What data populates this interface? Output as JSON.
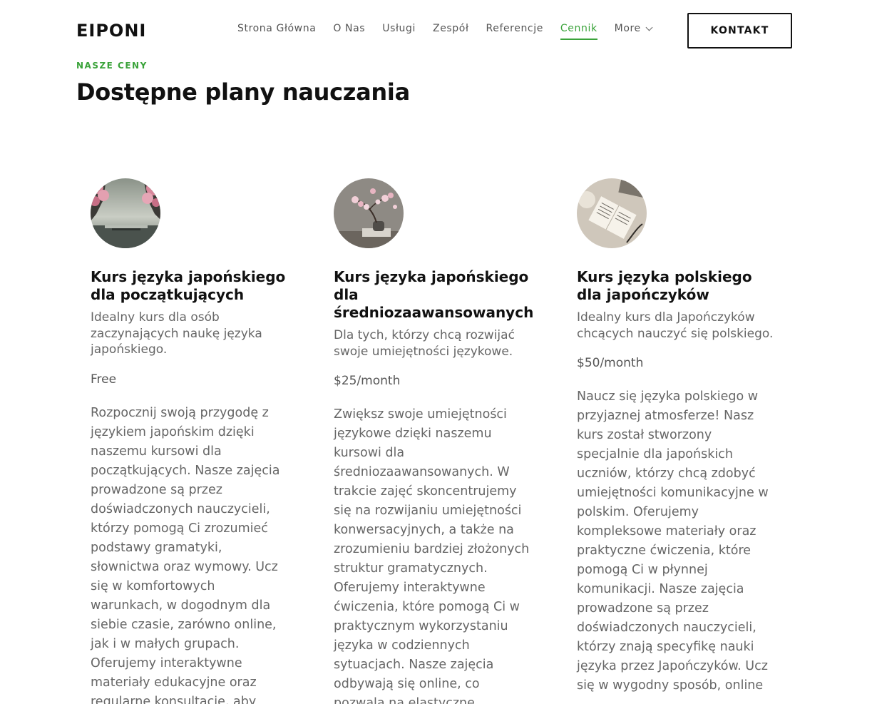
{
  "header": {
    "logo": "EIPONI",
    "nav": [
      {
        "label": "Strona Główna",
        "active": false
      },
      {
        "label": "O Nas",
        "active": false
      },
      {
        "label": "Usługi",
        "active": false
      },
      {
        "label": "Zespół",
        "active": false
      },
      {
        "label": "Referencje",
        "active": false
      },
      {
        "label": "Cennik",
        "active": true
      }
    ],
    "more_label": "More",
    "cta_label": "KONTAKT"
  },
  "section": {
    "eyebrow": "NASZE CENY",
    "title": "Dostępne plany nauczania"
  },
  "colors": {
    "accent": "#3aa33a",
    "text": "#111111",
    "muted": "#666666"
  },
  "plans": [
    {
      "title": "Kurs języka japońskiego dla początkujących",
      "subtitle": "Idealny kurs dla osób zaczynających naukę języka japońskiego.",
      "price": "Free",
      "description": "Rozpocznij swoją przygodę z językiem japońskim dzięki naszemu kursowi dla początkujących. Nasze zajęcia prowadzone są przez doświadczonych nauczycieli, którzy pomogą Ci zrozumieć podstawy gramatyki, słownictwa oraz wymowy. Ucz się w komfortowych warunkach, w dogodnym dla siebie czasie, zarówno online, jak i w małych grupach. Oferujemy interaktywne materiały edukacyjne oraz regularne konsultacje, aby",
      "image": "cherry-blossom-lake-image"
    },
    {
      "title": "Kurs języka japońskiego dla średniozaawansowanych",
      "subtitle": "Dla tych, którzy chcą rozwijać swoje umiejętności językowe.",
      "price": "$25/month",
      "description": "Zwiększ swoje umiejętności językowe dzięki naszemu kursowi dla średniozaawansowanych. W trakcie zajęć skoncentrujemy się na rozwijaniu umiejętności konwersacyjnych, a także na zrozumieniu bardziej złożonych struktur gramatycznych. Oferujemy interaktywne ćwiczenia, które pomogą Ci w praktycznym wykorzystaniu języka w codziennych sytuacjach. Nasze zajęcia odbywają się online, co pozwala na elastyczne",
      "image": "cherry-blossom-branch-image"
    },
    {
      "title": "Kurs języka polskiego dla japończyków",
      "subtitle": "Idealny kurs dla Japończyków chcących nauczyć się polskiego.",
      "price": "$50/month",
      "description": "Naucz się języka polskiego w przyjaznej atmosferze! Nasz kurs został stworzony specjalnie dla japońskich uczniów, którzy chcą zdobyć umiejętności komunikacyjne w polskim. Oferujemy kompleksowe materiały oraz praktyczne ćwiczenia, które pomogą Ci w płynnej komunikacji. Nasze zajęcia prowadzone są przez doświadczonych nauczycieli, którzy znają specyfikę nauki języka przez Japończyków. Ucz się w wygodny sposób, online",
      "image": "open-notebook-image"
    }
  ]
}
